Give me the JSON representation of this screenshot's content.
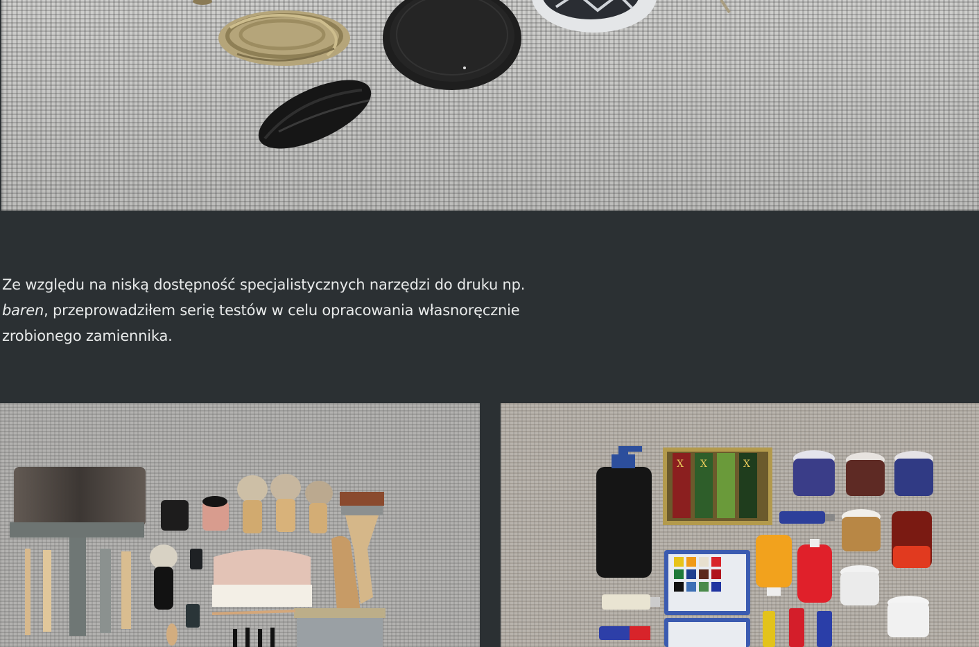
{
  "description": {
    "line1": "Ze względu na niską dostępność specjalistycznych narzędzi do druku np.",
    "line2_italic": "baren",
    "line2_rest": ", przeprowadziłem serię testów w celu opracowania własnoręcznie",
    "line3": "zrobionego zamiennika."
  },
  "right_photo": {
    "ink_stick_glyphs": [
      "X",
      "X",
      "X"
    ]
  },
  "colors": {
    "background": "#2b3033",
    "text": "#e8eaea"
  }
}
